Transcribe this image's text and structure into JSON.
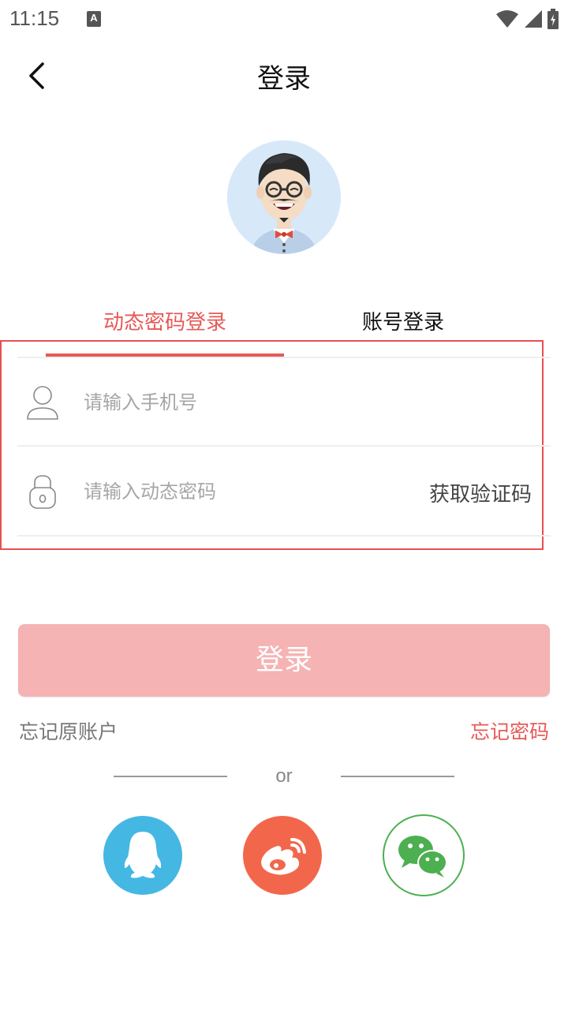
{
  "status_bar": {
    "time": "11:15",
    "notification_icon": "a-icon",
    "icons": [
      "wifi-icon",
      "signal-icon",
      "battery-icon"
    ]
  },
  "header": {
    "title": "登录",
    "back_icon": "chevron-left-icon"
  },
  "tabs": [
    {
      "label": "动态密码登录",
      "active": true
    },
    {
      "label": "账号登录",
      "active": false
    }
  ],
  "form": {
    "phone": {
      "placeholder": "请输入手机号",
      "value": "",
      "icon": "user-icon"
    },
    "code": {
      "placeholder": "请输入动态密码",
      "value": "",
      "icon": "lock-icon",
      "get_code_label": "获取验证码"
    }
  },
  "login_button": {
    "label": "登录"
  },
  "links": {
    "forgot_account": "忘记原账户",
    "forgot_password": "忘记密码"
  },
  "divider_text": "or",
  "social_logins": [
    {
      "name": "qq",
      "icon": "qq-icon",
      "color": "#45b7e3"
    },
    {
      "name": "weibo",
      "icon": "weibo-icon",
      "color": "#f2674b"
    },
    {
      "name": "wechat",
      "icon": "wechat-icon",
      "color": "#4caf50"
    }
  ],
  "colors": {
    "accent": "#e55a57",
    "button_disabled": "#f5b3b3"
  }
}
